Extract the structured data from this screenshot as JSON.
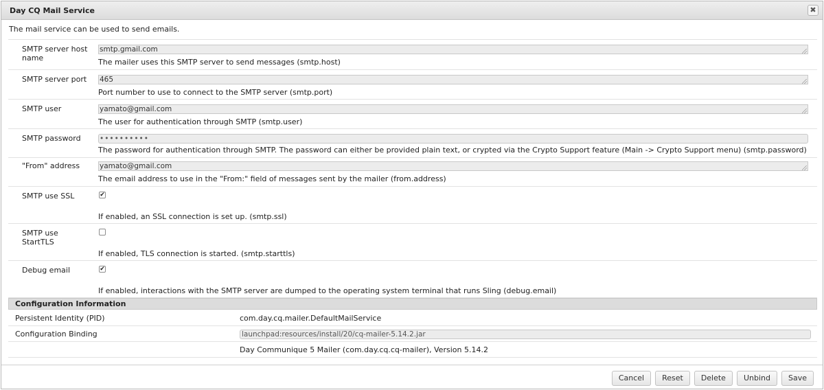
{
  "dialog": {
    "title": "Day CQ Mail Service",
    "close_label": "✖",
    "intro": "The mail service can be used to send emails."
  },
  "properties": [
    {
      "label": "SMTP server host name",
      "value": "smtp.gmail.com",
      "description": "The mailer uses this SMTP server to send messages (smtp.host)"
    },
    {
      "label": "SMTP server port",
      "value": "465",
      "description": "Port number to use to connect to the SMTP server (smtp.port)"
    },
    {
      "label": "SMTP user",
      "value": "yamato@gmail.com",
      "description": "The user for authentication through SMTP (smtp.user)"
    },
    {
      "label": "SMTP password",
      "value": "••••••••••",
      "description": "The password for authentication through SMTP. The password can either be provided plain text, or crypted via the Crypto Support feature (Main -> Crypto Support menu) (smtp.password)"
    },
    {
      "label": "\"From\" address",
      "value": "yamato@gmail.com",
      "description": "The email address to use in the \"From:\" field of messages sent by the mailer (from.address)"
    },
    {
      "label": "SMTP use SSL",
      "checked": true,
      "description": "If enabled, an SSL connection is set up. (smtp.ssl)"
    },
    {
      "label": "SMTP use StartTLS",
      "checked": false,
      "description": "If enabled, TLS connection is started. (smtp.starttls)"
    },
    {
      "label": "Debug email",
      "checked": true,
      "description": "If enabled, interactions with the SMTP server are dumped to the operating system terminal that runs Sling (debug.email)"
    }
  ],
  "config": {
    "heading": "Configuration Information",
    "pid_label": "Persistent Identity (PID)",
    "pid_value": "com.day.cq.mailer.DefaultMailService",
    "binding_label": "Configuration Binding",
    "binding_value": "launchpad:resources/install/20/cq-mailer-5.14.2.jar",
    "bundle": "Day Communique 5 Mailer (com.day.cq.cq-mailer), Version 5.14.2"
  },
  "buttons": {
    "cancel": "Cancel",
    "reset": "Reset",
    "delete": "Delete",
    "unbind": "Unbind",
    "save": "Save"
  },
  "check_glyph": "✔"
}
